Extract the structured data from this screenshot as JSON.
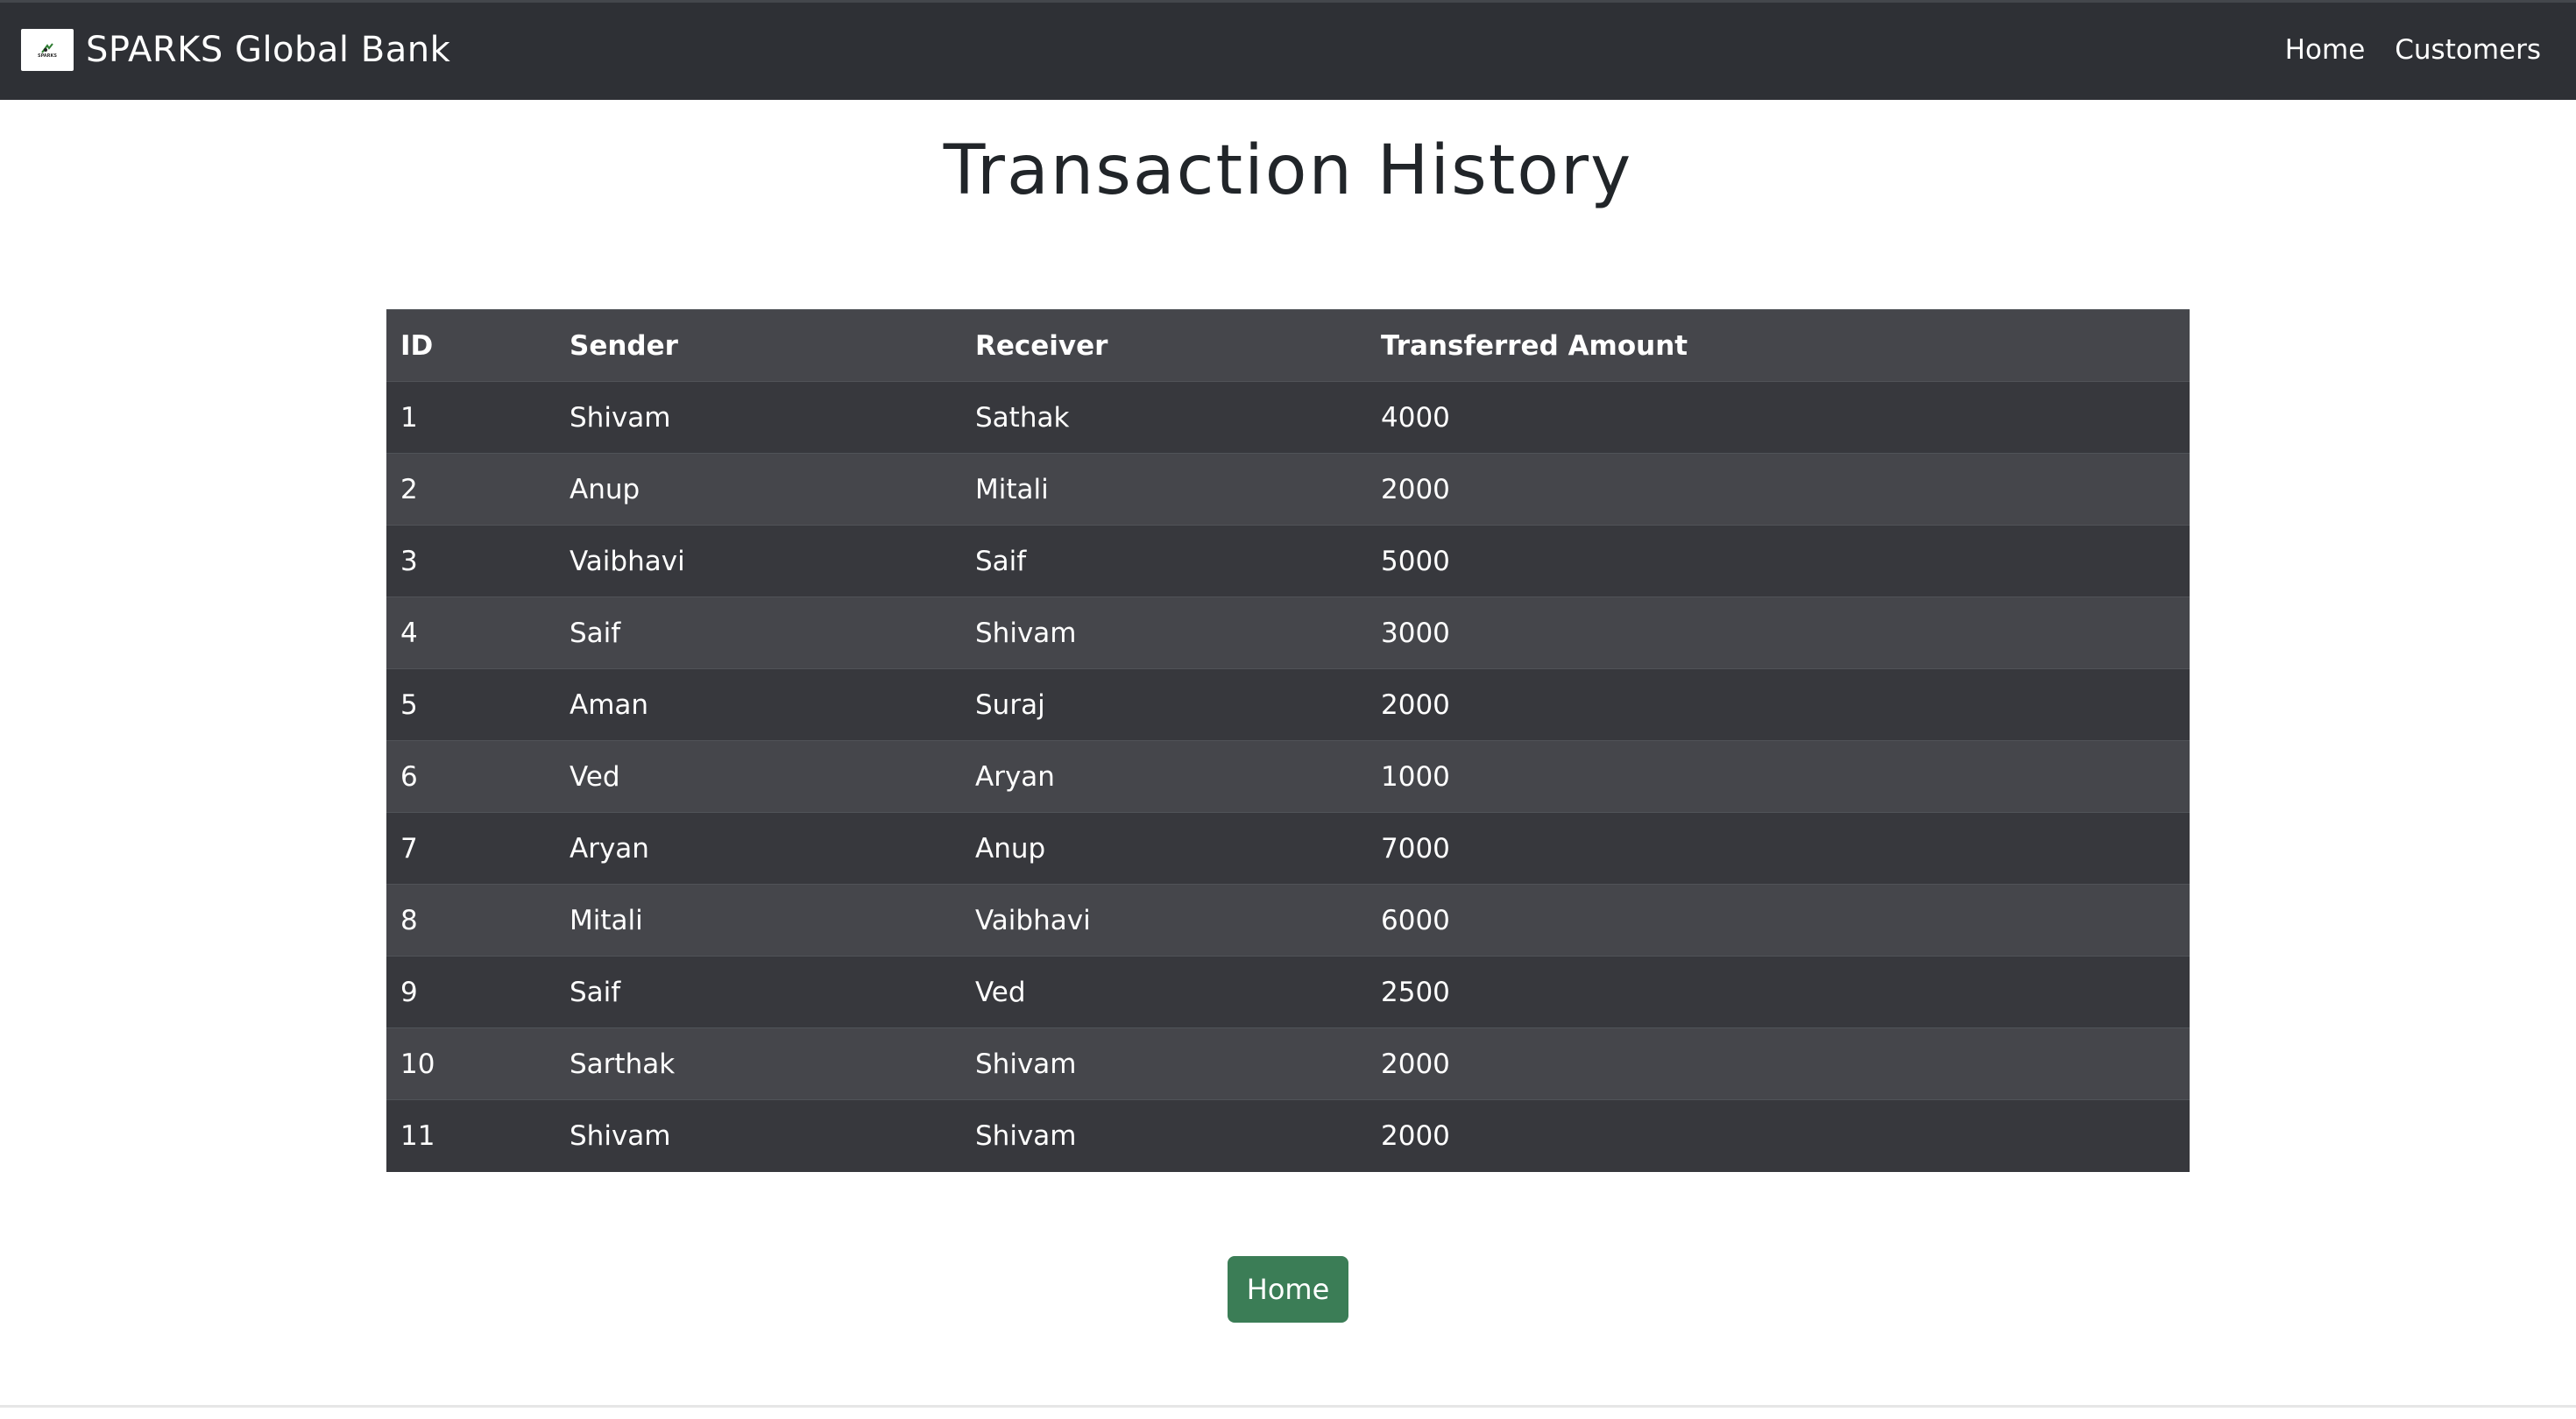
{
  "navbar": {
    "brand": "SPARKS Global Bank",
    "logo_text": "SPARKS",
    "links": [
      "Home",
      "Customers"
    ]
  },
  "page": {
    "title": "Transaction History"
  },
  "table": {
    "headers": [
      "ID",
      "Sender",
      "Receiver",
      "Transferred Amount"
    ],
    "rows": [
      [
        "1",
        "Shivam",
        "Sathak",
        "4000"
      ],
      [
        "2",
        "Anup",
        "Mitali",
        "2000"
      ],
      [
        "3",
        "Vaibhavi",
        "Saif",
        "5000"
      ],
      [
        "4",
        "Saif",
        "Shivam",
        "3000"
      ],
      [
        "5",
        "Aman",
        "Suraj",
        "2000"
      ],
      [
        "6",
        "Ved",
        "Aryan",
        "1000"
      ],
      [
        "7",
        "Aryan",
        "Anup",
        "7000"
      ],
      [
        "8",
        "Mitali",
        "Vaibhavi",
        "6000"
      ],
      [
        "9",
        "Saif",
        "Ved",
        "2500"
      ],
      [
        "10",
        "Sarthak",
        "Shivam",
        "2000"
      ],
      [
        "11",
        "Shivam",
        "Shivam",
        "2000"
      ]
    ]
  },
  "actions": {
    "home_button": "Home"
  },
  "colors": {
    "navbar_bg": "#2e3035",
    "table_dark": "#37383d",
    "table_light": "#45464b",
    "button_green": "#3b7d56"
  }
}
